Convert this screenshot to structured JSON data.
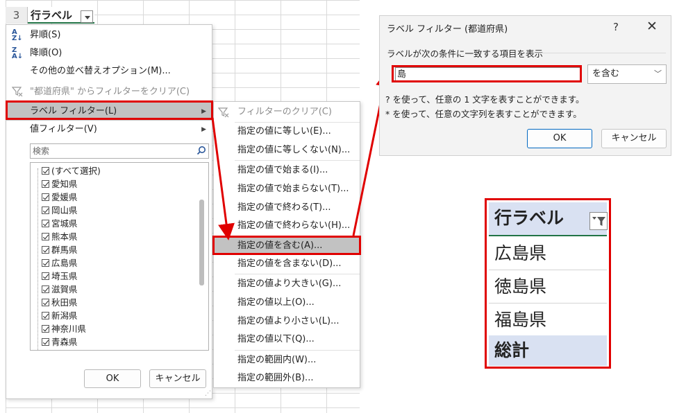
{
  "sheet": {
    "row_number": "3",
    "header_cell": "行ラベル"
  },
  "menu": {
    "items": [
      {
        "label": "昇順(S)",
        "icon": "sort-ascending-icon"
      },
      {
        "label": "降順(O)",
        "icon": "sort-descending-icon"
      },
      {
        "label": "その他の並べ替えオプション(M)..."
      },
      {
        "label": "\"都道府県\" からフィルターをクリア(C)",
        "icon": "clear-filter-icon"
      },
      {
        "label": "ラベル フィルター(L)"
      },
      {
        "label": "値フィルター(V)"
      }
    ],
    "search_placeholder": "検索",
    "checklist": [
      "(すべて選択)",
      "愛知県",
      "愛媛県",
      "岡山県",
      "宮城県",
      "熊本県",
      "群馬県",
      "広島県",
      "埼玉県",
      "滋賀県",
      "秋田県",
      "新潟県",
      "神奈川県",
      "青森県"
    ],
    "ok_label": "OK",
    "cancel_label": "キャンセル"
  },
  "submenu": {
    "items": [
      "フィルターのクリア(C)",
      "指定の値に等しい(E)...",
      "指定の値に等しくない(N)...",
      "指定の値で始まる(I)...",
      "指定の値で始まらない(T)...",
      "指定の値で終わる(T)...",
      "指定の値で終わらない(H)...",
      "指定の値を含む(A)...",
      "指定の値を含まない(D)...",
      "指定の値より大きい(G)...",
      "指定の値以上(O)...",
      "指定の値より小さい(L)...",
      "指定の値以下(Q)...",
      "指定の範囲内(W)...",
      "指定の範囲外(B)..."
    ]
  },
  "dialog": {
    "title": "ラベル フィルター (都道府県)",
    "help": "?",
    "close": "✕",
    "label": "ラベルが次の条件に一致する項目を表示",
    "input_value": "島",
    "condition": "を含む",
    "hint1": "? を使って、任意の 1 文字を表すことができます。",
    "hint2": "* を使って、任意の文字列を表すことができます。",
    "ok_label": "OK",
    "cancel_label": "キャンセル"
  },
  "result": {
    "header": "行ラベル",
    "rows": [
      "広島県",
      "徳島県",
      "福島県"
    ],
    "total": "総計"
  },
  "colors": {
    "highlight_red": "#e00000",
    "pivot_blue": "#d9e1f2",
    "excel_green": "#217346"
  }
}
